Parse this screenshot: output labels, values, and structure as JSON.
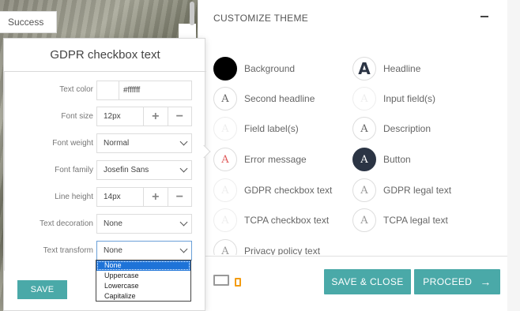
{
  "preview": {
    "success_label": "Success"
  },
  "customize": {
    "section_title": "CUSTOMIZE THEME",
    "items_left": [
      {
        "label": "Background",
        "glyph": ""
      },
      {
        "label": "Second headline",
        "glyph": "A"
      },
      {
        "label": "Field label(s)",
        "glyph": "A"
      },
      {
        "label": "Error message",
        "glyph": "A"
      },
      {
        "label": "GDPR checkbox text",
        "glyph": "A"
      },
      {
        "label": "TCPA checkbox text",
        "glyph": "A"
      },
      {
        "label": "Privacy policy text",
        "glyph": "A"
      }
    ],
    "items_right": [
      {
        "label": "Headline",
        "glyph": "A"
      },
      {
        "label": "Input field(s)",
        "glyph": "A"
      },
      {
        "label": "Description",
        "glyph": "A"
      },
      {
        "label": "Button",
        "glyph": "A"
      },
      {
        "label": "GDPR legal text",
        "glyph": "A"
      },
      {
        "label": "TCPA legal text",
        "glyph": "A"
      }
    ]
  },
  "footer": {
    "save_close_label": "SAVE & CLOSE",
    "proceed_label": "PROCEED",
    "proceed_arrow": "→"
  },
  "popup": {
    "title": "GDPR checkbox text",
    "text_color_label": "Text color",
    "text_color_value": "#ffffff",
    "font_size_label": "Font size",
    "font_size_value": "12px",
    "font_weight_label": "Font weight",
    "font_weight_value": "Normal",
    "font_family_label": "Font family",
    "font_family_value": "Josefin Sans",
    "line_height_label": "Line height",
    "line_height_value": "14px",
    "text_decoration_label": "Text decoration",
    "text_decoration_value": "None",
    "text_transform_label": "Text transform",
    "text_transform_value": "None",
    "plus_glyph": "+",
    "minus_glyph": "−",
    "save_label": "SAVE",
    "transform_options": [
      "None",
      "Uppercase",
      "Lowercase",
      "Capitalize"
    ]
  },
  "colors": {
    "accent": "#4aa9a8",
    "button_swatch": "#2b3444",
    "error_swatch_text": "#e05a5a",
    "mobile_icon": "#f39c12",
    "dropdown_selected": "#1e73d8"
  }
}
